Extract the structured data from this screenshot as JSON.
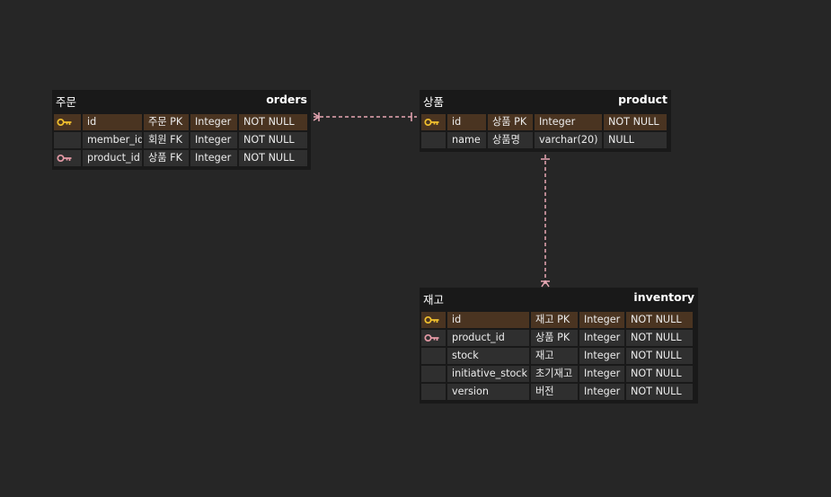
{
  "colors": {
    "background": "#262626",
    "table_bg": "#191919",
    "cell_bg": "#2f2f2f",
    "pk_row_bg": "#4a3421",
    "pk_key": "#f2c12e",
    "fk_key": "#e59aa6",
    "relation_line": "#e8a7b4"
  },
  "tables": {
    "orders": {
      "label": "주문",
      "name": "orders",
      "columns": [
        {
          "key": "pk",
          "name": "id",
          "comment": "주문 PK",
          "type": "Integer",
          "nullable": "NOT NULL"
        },
        {
          "key": "",
          "name": "member_id",
          "comment": "회원 FK",
          "type": "Integer",
          "nullable": "NOT NULL"
        },
        {
          "key": "fk",
          "name": "product_id",
          "comment": "상품 FK",
          "type": "Integer",
          "nullable": "NOT NULL"
        }
      ]
    },
    "product": {
      "label": "상품",
      "name": "product",
      "columns": [
        {
          "key": "pk",
          "name": "id",
          "comment": "상품 PK",
          "type": "Integer",
          "nullable": "NOT NULL"
        },
        {
          "key": "",
          "name": "name",
          "comment": "상품명",
          "type": "varchar(20)",
          "nullable": "NULL"
        }
      ]
    },
    "inventory": {
      "label": "재고",
      "name": "inventory",
      "columns": [
        {
          "key": "pk",
          "name": "id",
          "comment": "재고 PK",
          "type": "Integer",
          "nullable": "NOT NULL"
        },
        {
          "key": "fk",
          "name": "product_id",
          "comment": "상품 PK",
          "type": "Integer",
          "nullable": "NOT NULL"
        },
        {
          "key": "",
          "name": "stock",
          "comment": "재고",
          "type": "Integer",
          "nullable": "NOT NULL"
        },
        {
          "key": "",
          "name": "initiative_stock",
          "comment": "초기재고",
          "type": "Integer",
          "nullable": "NOT NULL"
        },
        {
          "key": "",
          "name": "version",
          "comment": "버전",
          "type": "Integer",
          "nullable": "NOT NULL"
        }
      ]
    }
  },
  "relations": [
    {
      "from": "orders",
      "to": "product",
      "from_end": "many",
      "to_end": "one"
    },
    {
      "from": "product",
      "to": "inventory",
      "from_end": "one",
      "to_end": "many"
    }
  ]
}
